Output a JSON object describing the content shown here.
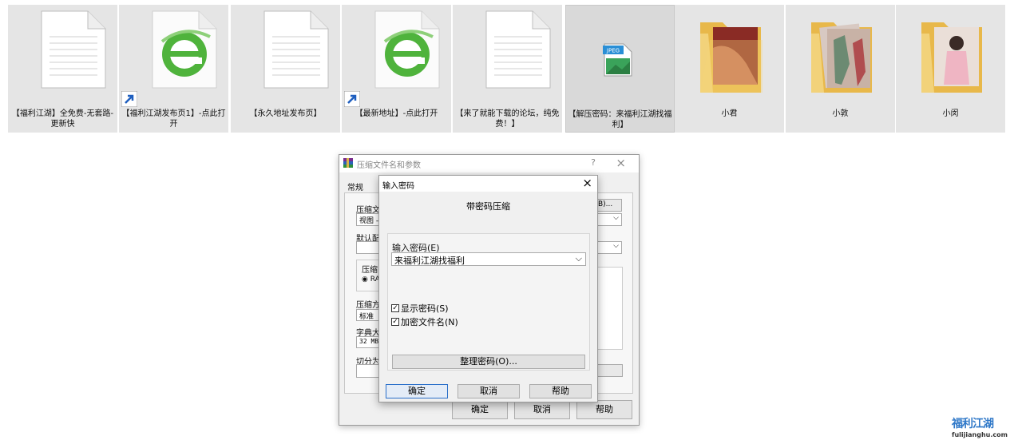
{
  "explorer": {
    "items": [
      {
        "label": "【福利江湖】全免费-无套路-更新快",
        "kind": "text-file"
      },
      {
        "label": "【福利江湖发布页1】-点此打开",
        "kind": "ie-shortcut"
      },
      {
        "label": "【永久地址发布页】",
        "kind": "text-file"
      },
      {
        "label": "【最新地址】-点此打开",
        "kind": "ie-shortcut"
      },
      {
        "label": "【来了就能下载的论坛，纯免费！】",
        "kind": "text-file"
      },
      {
        "label": "【解压密码：来福利江湖找福利】",
        "kind": "jpeg-file",
        "badge": "JPEG"
      },
      {
        "label": "小君",
        "kind": "image-folder"
      },
      {
        "label": "小敦",
        "kind": "image-folder"
      },
      {
        "label": "小闵",
        "kind": "image-folder"
      }
    ]
  },
  "back_dialog": {
    "title": "压缩文件名和参数",
    "help_glyph": "?",
    "close_glyph": "×",
    "tab_general": "常规",
    "archive_name_label": "压缩文",
    "archive_name_value": "视图 -",
    "browse_btn": "B)...",
    "profile_label": "默认配",
    "format_group": "压缩",
    "format_radio": "RA",
    "method_label": "压缩方",
    "method_value": "标准",
    "dict_label": "字典大",
    "dict_value": "32 MB",
    "split_label": "切分为",
    "ok": "确定",
    "cancel": "取消",
    "help": "帮助"
  },
  "front_dialog": {
    "title": "输入密码",
    "close_glyph": "×",
    "heading": "带密码压缩",
    "password_label": "输入密码(E)",
    "password_value": "来福利江湖找福利",
    "show_password": "显示密码(S)",
    "encrypt_names": "加密文件名(N)",
    "organize_btn": "整理密码(O)...",
    "ok": "确定",
    "cancel": "取消",
    "help": "帮助"
  },
  "watermark": {
    "line1": "福利江湖",
    "line2": "fulijianghu.com"
  }
}
